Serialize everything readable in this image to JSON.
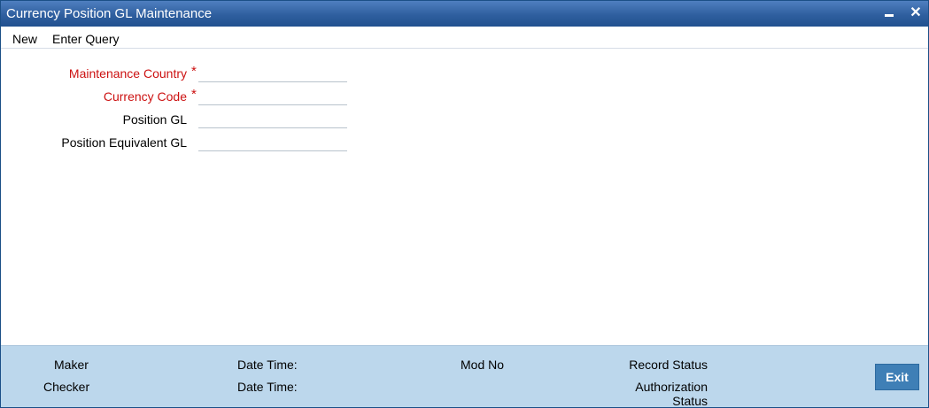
{
  "window": {
    "title": "Currency Position GL Maintenance",
    "minimize_icon": "minimize-icon",
    "close_icon": "close-icon",
    "close_glyph": "✕"
  },
  "toolbar": {
    "new_label": "New",
    "enter_query_label": "Enter Query"
  },
  "form": {
    "maintenance_country": {
      "label": "Maintenance Country",
      "required": true,
      "value": ""
    },
    "currency_code": {
      "label": "Currency Code",
      "required": true,
      "value": ""
    },
    "position_gl": {
      "label": "Position GL",
      "required": false,
      "value": ""
    },
    "position_equivalent_gl": {
      "label": "Position Equivalent GL",
      "required": false,
      "value": ""
    },
    "required_marker": "*"
  },
  "footer": {
    "maker_label": "Maker",
    "checker_label": "Checker",
    "maker_datetime_label": "Date Time:",
    "checker_datetime_label": "Date Time:",
    "mod_no_label": "Mod No",
    "record_status_label": "Record Status",
    "authorization_label_line1": "Authorization",
    "authorization_label_line2": "Status",
    "exit_label": "Exit"
  },
  "colors": {
    "titlebar": "#2f5f9f",
    "required_label": "#cc1111",
    "footer_bg": "#bcd7ec",
    "exit_button": "#3f7fb6"
  }
}
